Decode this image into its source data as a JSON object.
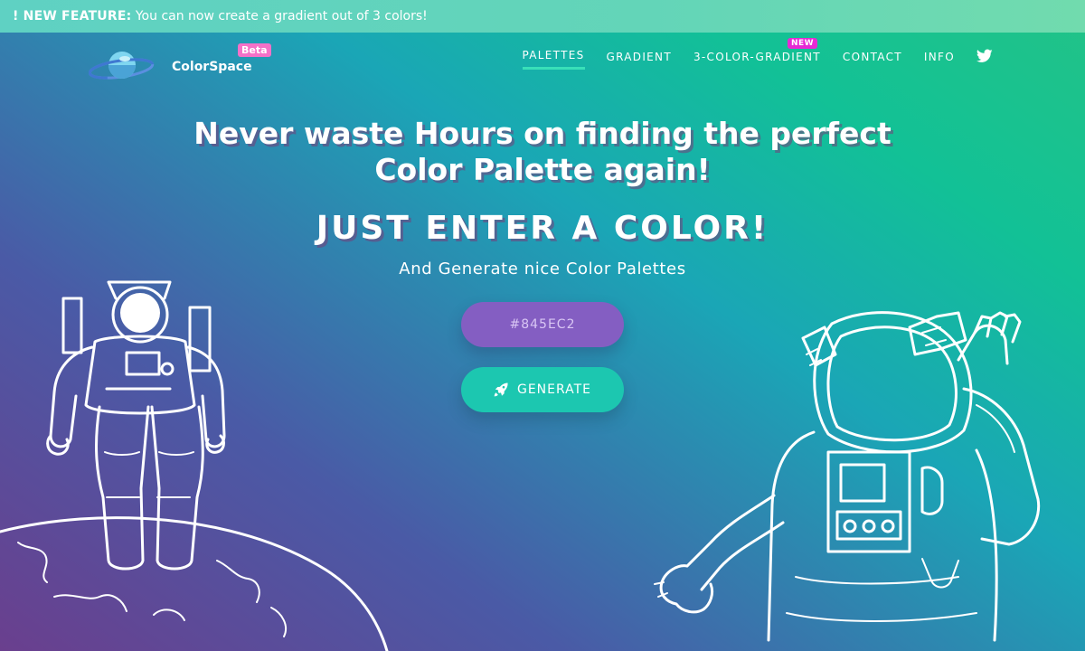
{
  "announcement": {
    "label": "! NEW FEATURE:",
    "text": " You can now create a gradient out of 3 colors!"
  },
  "brand": {
    "name": "ColorSpace",
    "badge": "Beta"
  },
  "nav": {
    "items": [
      {
        "label": "PALETTES",
        "active": true
      },
      {
        "label": "GRADIENT",
        "active": false
      },
      {
        "label": "3-COLOR-GRADIENT",
        "active": false,
        "badge": "NEW"
      },
      {
        "label": "CONTACT",
        "active": false
      },
      {
        "label": "INFO",
        "active": false
      }
    ],
    "social_icon": "twitter-icon"
  },
  "hero": {
    "title_line1": "Never waste Hours on finding the perfect",
    "title_line2": "Color Palette again!",
    "subtitle": "JUST ENTER A COLOR!",
    "description": "And Generate nice Color Palettes"
  },
  "form": {
    "color_value": "#845EC2",
    "generate_label": "GENERATE",
    "generate_icon": "rocket-icon"
  },
  "colors": {
    "input_bg": "#845ec2",
    "button_bg": "#1cc7b0",
    "accent": "#39e0b8",
    "beta_badge": "#f471c8",
    "new_badge": "#e62ad4"
  }
}
